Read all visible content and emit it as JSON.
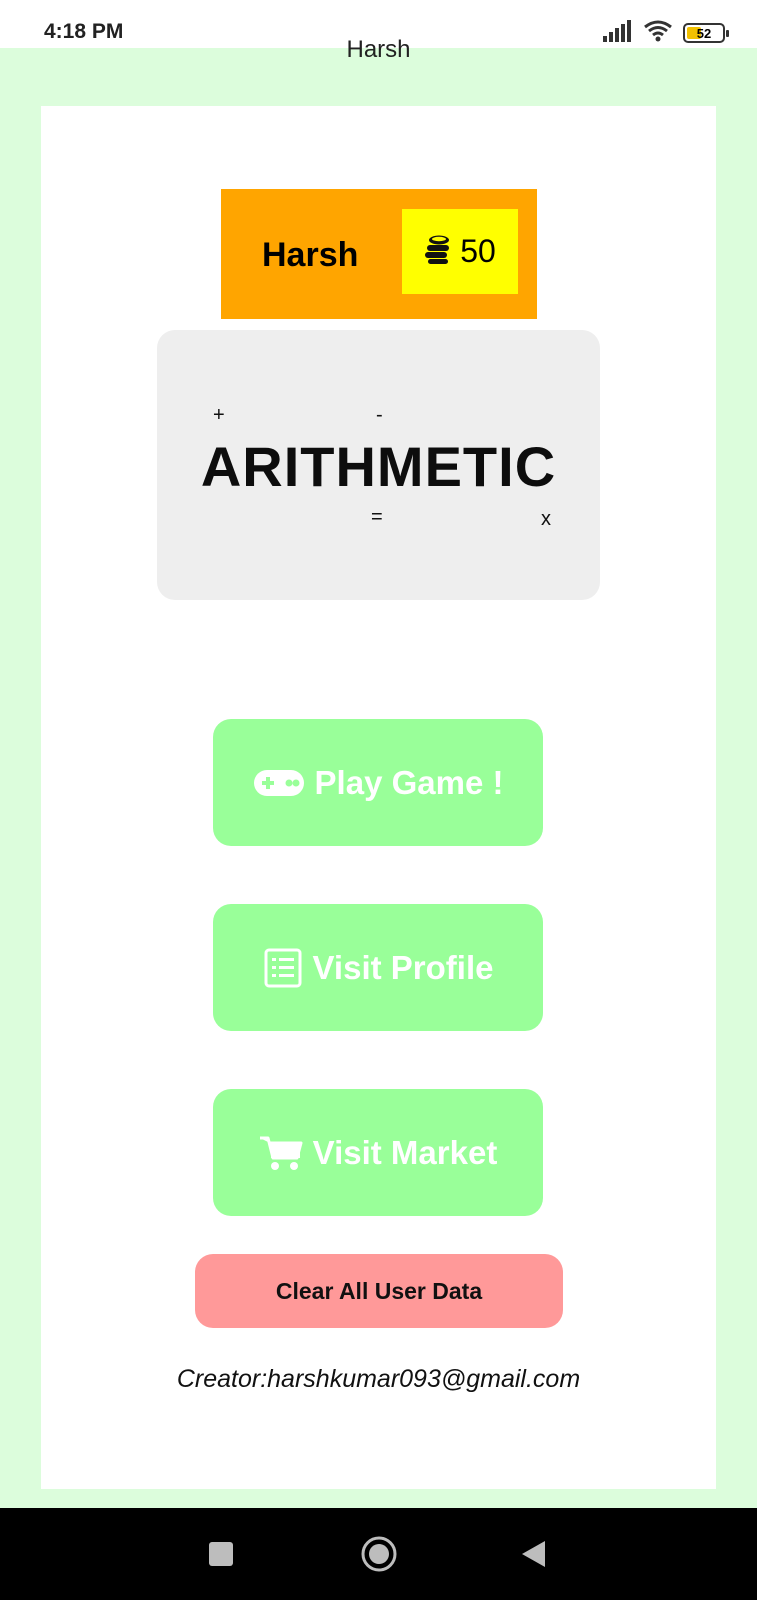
{
  "status_bar": {
    "time": "4:18 PM",
    "battery_level": "52",
    "icons": [
      "signal-icon",
      "wifi-icon",
      "battery-icon"
    ]
  },
  "app": {
    "title": "Harsh"
  },
  "user": {
    "name": "Harsh",
    "coins": "50",
    "coin_icon": "coins-icon"
  },
  "logo": {
    "text": "ARITHMETIC",
    "symbols": {
      "plus": "+",
      "minus": "-",
      "equals": "=",
      "times": "x"
    }
  },
  "menu": {
    "play_label": "Play Game !",
    "profile_label": "Visit Profile",
    "market_label": "Visit Market",
    "clear_label": "Clear All User Data"
  },
  "footer": {
    "creator": "Creator:harshkumar093@gmail.com"
  },
  "nav": {
    "icons": [
      "recents-square-icon",
      "home-circle-icon",
      "back-triangle-icon"
    ]
  },
  "colors": {
    "background": "#dcfddc",
    "card": "#ffffff",
    "banner": "#ffa500",
    "coin_box": "#ffff00",
    "menu_button": "#99ff99",
    "clear_button": "#ff9999",
    "logo_panel": "#eeeeee"
  }
}
